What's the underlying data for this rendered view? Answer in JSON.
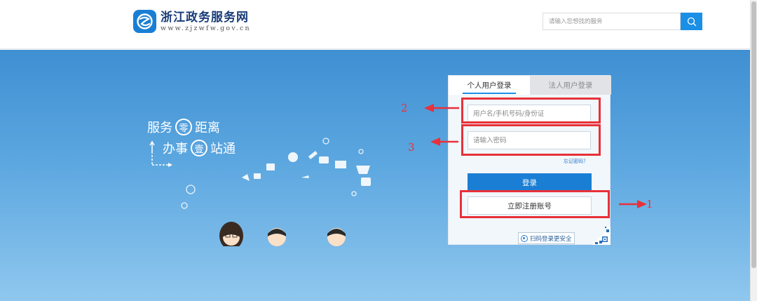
{
  "header": {
    "logo_cn": "浙江政务服务网",
    "logo_en": "www.zjzwfw.gov.cn",
    "logo_icon": "zj-gov-logo-icon",
    "search_placeholder": "请输入您想找的服务",
    "search_icon": "search-icon"
  },
  "hero": {
    "slogan_line1": [
      "服务",
      "零",
      "距离"
    ],
    "slogan_line2": [
      "办事",
      "壹",
      "站通"
    ]
  },
  "login": {
    "tabs": [
      {
        "label": "个人用户登录",
        "active": true
      },
      {
        "label": "法人用户登录",
        "active": false
      }
    ],
    "username_placeholder": "用户名/手机号码/身份证",
    "password_placeholder": "请输入密码",
    "forgot_password": "忘记密码？",
    "login_button": "登录",
    "register_button": "立即注册账号",
    "qr_login": "扫码登录更安全"
  },
  "annotations": {
    "marker_register": "1",
    "marker_username": "2",
    "marker_password": "3",
    "highlight_color": "#e8313a"
  },
  "colors": {
    "brand_blue": "#1a7fd4",
    "search_blue": "#1a8fe6"
  }
}
